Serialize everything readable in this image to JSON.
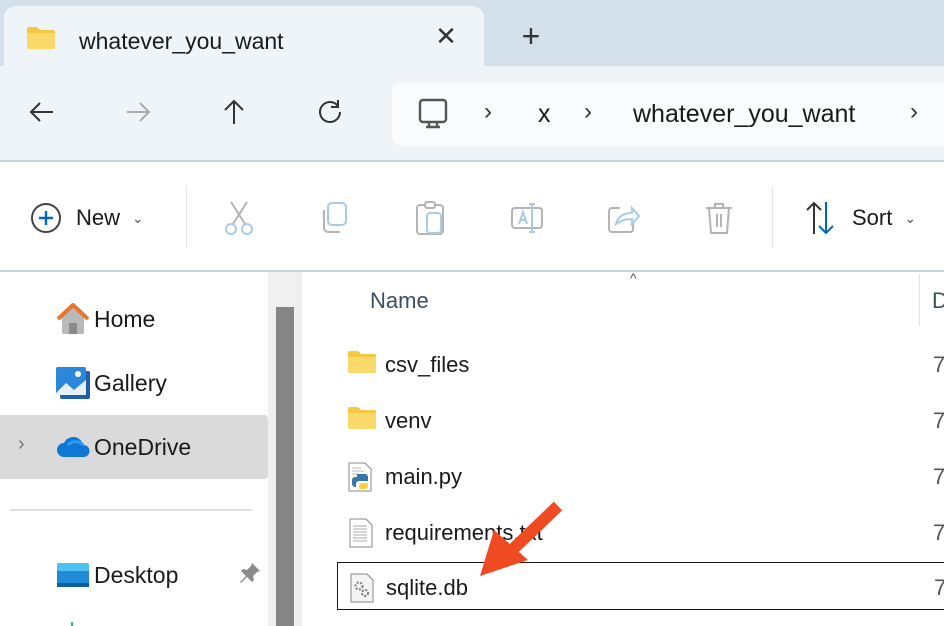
{
  "window": {
    "tab": {
      "title": "whatever_you_want",
      "icon": "folder-icon"
    },
    "new_tab_label": "+",
    "close_tab_label": "✕"
  },
  "nav": {
    "back": "back-arrow-icon",
    "forward": "forward-arrow-icon",
    "up": "up-arrow-icon",
    "refresh": "refresh-icon"
  },
  "address": {
    "root_icon": "this-pc-icon",
    "crumbs": [
      "x",
      "whatever_you_want"
    ],
    "separator": "›"
  },
  "toolbar": {
    "new_label": "New",
    "sort_label": "Sort",
    "caret": "⌄",
    "actions": [
      "cut",
      "copy",
      "paste",
      "rename",
      "share",
      "delete"
    ]
  },
  "sidebar": {
    "items": [
      {
        "label": "Home",
        "icon": "home-icon"
      },
      {
        "label": "Gallery",
        "icon": "gallery-icon"
      },
      {
        "label": "OneDrive",
        "icon": "onedrive-icon",
        "selected": true,
        "expander": "›"
      },
      {
        "label": "Desktop",
        "icon": "desktop-icon",
        "pinned": true
      }
    ]
  },
  "files": {
    "columns": [
      "Name",
      "D"
    ],
    "sort_indicator": "^",
    "rows": [
      {
        "name": "csv_files",
        "type": "folder",
        "date": "7"
      },
      {
        "name": "venv",
        "type": "folder",
        "date": "7"
      },
      {
        "name": "main.py",
        "type": "python",
        "date": "7"
      },
      {
        "name": "requirements.txt",
        "type": "text",
        "date": "7"
      },
      {
        "name": "sqlite.db",
        "type": "db",
        "date": "7",
        "focused": true
      }
    ]
  },
  "annotation": {
    "type": "arrow",
    "color": "#f04a23",
    "points_to": "sqlite.db"
  },
  "colors": {
    "accent": "#0067c0",
    "tab_strip": "#d3e0ea",
    "nav_bg": "#eff4f9",
    "selected_bg": "#dadada"
  }
}
